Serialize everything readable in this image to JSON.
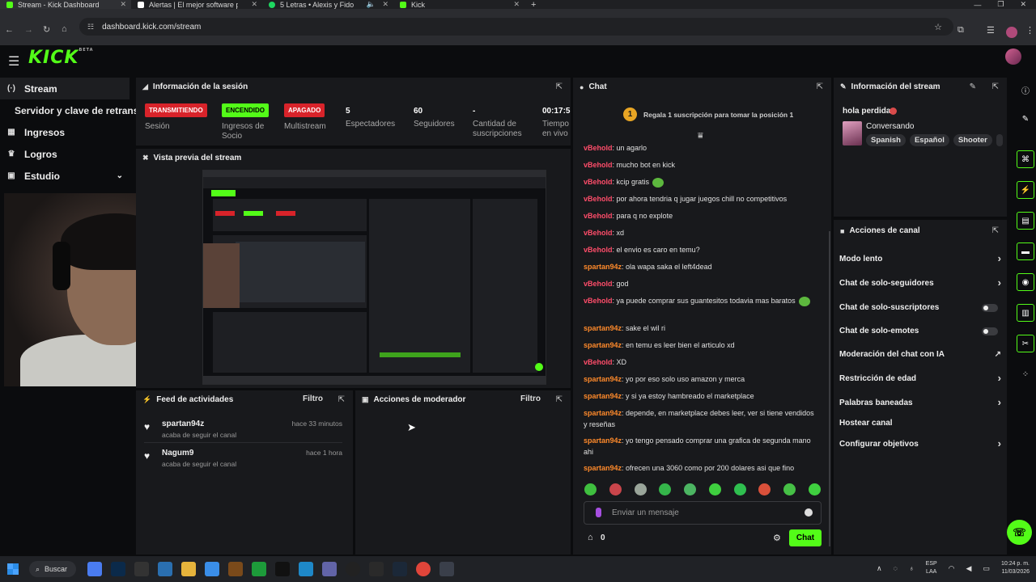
{
  "browser": {
    "tabs": [
      {
        "title": "Stream - Kick Dashboard",
        "color": "#53fc18",
        "active": true
      },
      {
        "title": "Alertas | El mejor software para",
        "color": "#ffffff",
        "active": false
      },
      {
        "title": "5 Letras • Alexis y Fido",
        "color": "#1ed760",
        "active": false
      },
      {
        "title": "Kick",
        "color": "#53fc18",
        "active": false
      }
    ],
    "url": "dashboard.kick.com/stream"
  },
  "app": {
    "logo": "KICK",
    "logo_badge": "BETA"
  },
  "sidebar": {
    "items": [
      {
        "label": "Stream",
        "icon": "stream-icon"
      },
      {
        "label": "Servidor y clave de retransmisión",
        "icon": ""
      },
      {
        "label": "Ingresos",
        "icon": "money-icon"
      },
      {
        "label": "Logros",
        "icon": "trophy-icon"
      },
      {
        "label": "Estudio",
        "icon": "studio-icon"
      }
    ]
  },
  "session": {
    "title": "Información de la sesión",
    "cols": [
      {
        "value": "TRANSMITIENDO",
        "kind": "red",
        "label": "Sesión"
      },
      {
        "value": "ENCENDIDO",
        "kind": "green",
        "label": "Ingresos de Socio"
      },
      {
        "value": "APAGADO",
        "kind": "red",
        "label": "Multistream"
      },
      {
        "value": "5",
        "kind": "text",
        "label": "Espectadores"
      },
      {
        "value": "60",
        "kind": "text",
        "label": "Seguidores"
      },
      {
        "value": "-",
        "kind": "text",
        "label": "Cantidad de suscripciones"
      },
      {
        "value": "00:17:5",
        "kind": "text",
        "label": "Tiempo en vivo"
      }
    ]
  },
  "preview": {
    "title": "Vista previa del stream"
  },
  "feed": {
    "title": "Feed de actividades",
    "filter": "Filtro",
    "items": [
      {
        "name": "spartan94z",
        "action": "acaba de seguir el canal",
        "time": "hace 33 minutos"
      },
      {
        "name": "Nagum9",
        "action": "acaba de seguir el canal",
        "time": "hace 1 hora"
      }
    ]
  },
  "mod": {
    "title": "Acciones de moderador",
    "filter": "Filtro"
  },
  "chat": {
    "title": "Chat",
    "gift_rank": "1",
    "gift_text": "Regala 1 suscripción para tomar la posición 1",
    "messages": [
      {
        "user": "vBehold",
        "text": ": un agarlo",
        "emote": false
      },
      {
        "user": "vBehold",
        "text": ": mucho bot en kick",
        "emote": false
      },
      {
        "user": "vBehold",
        "text": ": kcip gratis",
        "emote": true
      },
      {
        "user": "vBehold",
        "text": ": por ahora tendria q jugar juegos chill no competitivos",
        "emote": false
      },
      {
        "user": "vBehold",
        "text": ": para q no explote",
        "emote": false
      },
      {
        "user": "vBehold",
        "text": ": xd",
        "emote": false
      },
      {
        "user": "vBehold",
        "text": ": el envio es caro en temu?",
        "emote": false
      },
      {
        "user": "spartan94z",
        "text": ": ola wapa saka el left4dead",
        "emote": false
      },
      {
        "user": "vBehold",
        "text": ": god",
        "emote": false
      },
      {
        "user": "vBehold",
        "text": ": ya puede comprar sus guantesitos todavia mas baratos",
        "emote": true
      },
      {
        "user": "spartan94z",
        "text": ": sake el wil ri",
        "emote": false
      },
      {
        "user": "spartan94z",
        "text": ": en temu es leer bien el articulo xd",
        "emote": false
      },
      {
        "user": "vBehold",
        "text": ": XD",
        "emote": false
      },
      {
        "user": "spartan94z",
        "text": ": yo por eso solo uso amazon y merca",
        "emote": false
      },
      {
        "user": "spartan94z",
        "text": ": y si ya estoy hambreado el marketplace",
        "emote": false
      },
      {
        "user": "spartan94z",
        "text": ": depende, en marketplace debes leer, ver si tiene vendidos y reseñas",
        "emote": false
      },
      {
        "user": "spartan94z",
        "text": ": yo tengo pensado comprar una grafica de segunda mano ahi",
        "emote": false
      },
      {
        "user": "spartan94z",
        "text": ": ofrecen una 3060 como por 200 dolares asi que fino",
        "emote": false
      }
    ],
    "input_placeholder": "Enviar un mensaje",
    "points": "0",
    "send_label": "Chat"
  },
  "stream_info": {
    "title": "Información del stream",
    "stream_title": "hola perdida",
    "category": "Conversando",
    "tags": [
      "Spanish",
      "Español",
      "Shooter"
    ]
  },
  "channel_actions": {
    "title": "Acciones de canal",
    "items": [
      {
        "label": "Modo lento",
        "control": "chevron"
      },
      {
        "label": "Chat de solo-seguidores",
        "control": "chevron"
      },
      {
        "label": "Chat de solo-suscriptores",
        "control": "toggle"
      },
      {
        "label": "Chat de solo-emotes",
        "control": "toggle"
      },
      {
        "label": "Moderación del chat con IA",
        "control": "external"
      },
      {
        "label": "Restricción de edad",
        "control": "chevron"
      },
      {
        "label": "Palabras baneadas",
        "control": "chevron"
      },
      {
        "label": "Hostear canal",
        "control": "none"
      },
      {
        "label": "Configurar objetivos",
        "control": "chevron"
      }
    ]
  },
  "taskbar": {
    "search": "Buscar",
    "lang_line1": "ESP",
    "lang_line2": "LAA",
    "time": "10:24 p. m.",
    "date": "11/03/2026"
  }
}
